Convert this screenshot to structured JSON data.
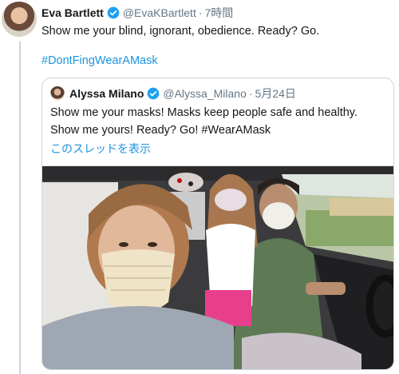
{
  "tweet": {
    "author_name": "Eva Bartlett",
    "author_handle": "@EvaKBartlett",
    "separator": "·",
    "time": "7時間",
    "text": "Show me your blind, ignorant, obedience. Ready? Go.",
    "hashtag": "#DontFingWearAMask"
  },
  "quoted_tweet": {
    "author_name": "Alyssa Milano",
    "author_handle": "@Alyssa_Milano",
    "separator": "·",
    "date": "5月24日",
    "text": "Show me your masks! Masks keep people safe and healthy. Show me yours! Ready? Go! #WearAMask",
    "show_thread": "このスレッドを表示"
  },
  "icons": {
    "verified": "verified-badge-icon"
  },
  "colors": {
    "verified": "#1da1f2",
    "link": "#1b95e0",
    "muted": "#657786"
  }
}
